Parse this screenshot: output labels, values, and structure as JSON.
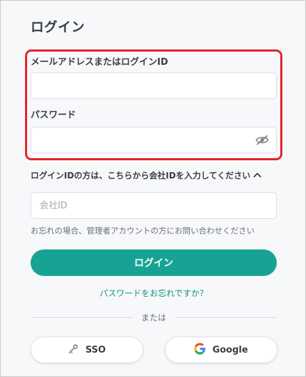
{
  "login": {
    "title": "ログイン",
    "email_label": "メールアドレスまたはログインID",
    "email_value": "",
    "password_label": "パスワード",
    "password_value": "",
    "company_toggle": "ログインIDの方は、こちらから会社IDを入力してください",
    "company_placeholder": "会社ID",
    "company_hint": "お忘れの場合、管理者アカウントの方にお問い合わせください",
    "login_button": "ログイン",
    "forgot_link": "パスワードをお忘れですか？",
    "divider": "または",
    "sso_button": "SSO",
    "google_button": "Google"
  },
  "icons": {
    "password_visibility": "eye-off-icon",
    "company_toggle": "chevron-up-icon",
    "sso": "key-icon",
    "google": "google-icon"
  },
  "colors": {
    "primary": "#17a393",
    "link": "#138f82",
    "highlight": "#e6202a",
    "text": "#3a3d45"
  }
}
